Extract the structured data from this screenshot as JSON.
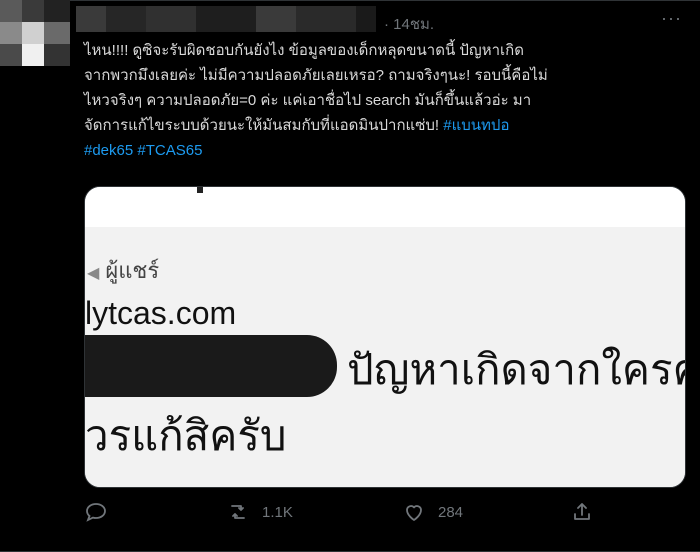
{
  "tweet": {
    "timestamp": "· 14ชม.",
    "more_label": "···",
    "text_line1": "ไหน!!!! ดูซิจะรับผิดชอบกันยังไง ข้อมูลของเด็กหลุดขนาดนี้ ปัญหาเกิด",
    "text_line2": "จากพวกมึงเลยค่ะ ไม่มีความปลอดภัยเลยเหรอ? ถามจริงๆนะ! รอบนี้คือไม่",
    "text_line3": "ไหวจริงๆ ความปลอดภัย=0 ค่ะ แค่เอาชื่อไป search มันก็ขึ้นแล้วอ่ะ มา",
    "text_line4": "จัดการแก้ไขระบบด้วยนะให้มันสมกับที่แอดมินปากแซ่บ!",
    "hashtag1": "#แบนทปอ",
    "hashtag2": "#dek65",
    "hashtag3": "#TCAS65"
  },
  "media": {
    "shared_label": "ผู้แชร์",
    "url_fragment": "lytcas.com",
    "line1": "ปัญหาเกิดจากใครค",
    "line2": "วรแก้สิครับ"
  },
  "actions": {
    "reply_count": "",
    "retweet_count": "1.1K",
    "like_count": "284"
  },
  "colors": {
    "background": "#000000",
    "text": "#d9d9d9",
    "muted": "#71767b",
    "link": "#1d9bf0"
  }
}
